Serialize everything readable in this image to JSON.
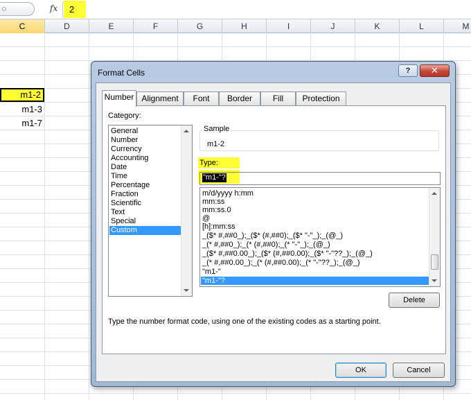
{
  "formula_bar": {
    "fx_label": "fx",
    "value": "2"
  },
  "columns": [
    "C",
    "D",
    "E",
    "F",
    "G",
    "H",
    "I",
    "J",
    "K",
    "L",
    "M"
  ],
  "selected_column": "C",
  "cells": [
    {
      "value": "m1-2",
      "active": true
    },
    {
      "value": "m1-3",
      "active": false
    },
    {
      "value": "m1-7",
      "active": false
    }
  ],
  "dialog": {
    "title": "Format Cells",
    "help_label": "?",
    "close_label": "✕",
    "tabs": [
      "Number",
      "Alignment",
      "Font",
      "Border",
      "Fill",
      "Protection"
    ],
    "active_tab": "Number",
    "category_label": "Category:",
    "categories": [
      "General",
      "Number",
      "Currency",
      "Accounting",
      "Date",
      "Time",
      "Percentage",
      "Fraction",
      "Scientific",
      "Text",
      "Special",
      "Custom"
    ],
    "selected_category": "Custom",
    "sample_label": "Sample",
    "sample_value": "m1-2",
    "type_label": "Type:",
    "type_value": "\"m1-\"?",
    "format_codes": [
      "m/d/yyyy h:mm",
      "mm:ss",
      "mm:ss.0",
      "@",
      "[h]:mm:ss",
      "_($* #,##0_);_($* (#,##0);_($* \"-\"_);_(@_)",
      "_(* #,##0_);_(* (#,##0);_(* \"-\"_);_(@_)",
      "_($* #,##0.00_);_($* (#,##0.00);_($* \"-\"??_);_(@_)",
      "_(* #,##0.00_);_(* (#,##0.00);_(* \"-\"??_);_(@_)",
      "\"m1-\"",
      "\"m1-\"?"
    ],
    "selected_format": "\"m1-\"?",
    "delete_label": "Delete",
    "hint": "Type the number format code, using one of the existing codes as a starting point.",
    "ok_label": "OK",
    "cancel_label": "Cancel",
    "colors": {
      "highlight": "#ffff33",
      "selection": "#3399ff",
      "close": "#c7493a"
    }
  }
}
